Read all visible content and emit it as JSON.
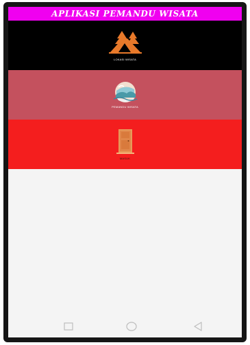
{
  "app": {
    "title": "APLIKASI PEMANDU WISATA"
  },
  "menu": [
    {
      "label": "LOKASI WISATA",
      "icon": "camping-tent-trees-icon",
      "color": "#000000"
    },
    {
      "label": "PEMANDU WISATA",
      "icon": "landscape-scene-icon",
      "color": "#c4515e"
    },
    {
      "label": "MASUK",
      "icon": "door-icon",
      "color": "#f41e1e"
    }
  ],
  "navbar": {
    "recents_icon": "square-icon",
    "home_icon": "circle-icon",
    "back_icon": "triangle-back-icon"
  },
  "colors": {
    "title_bar": "#f000f0",
    "screen_background": "#f4f4f4"
  }
}
